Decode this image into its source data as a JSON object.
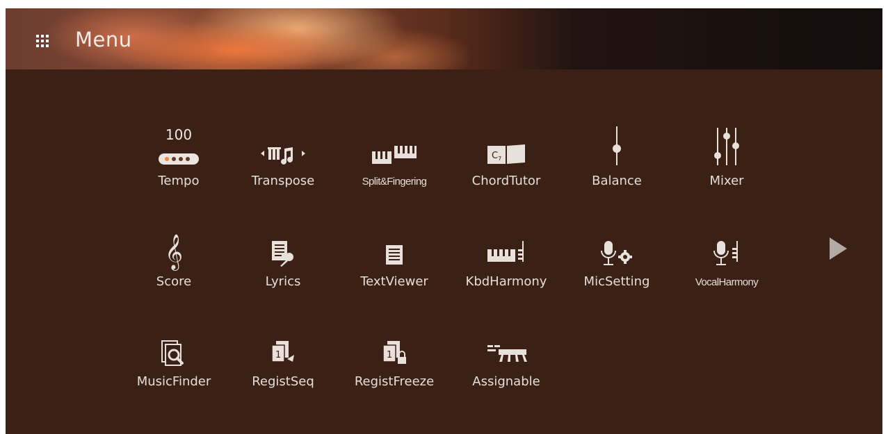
{
  "header": {
    "title": "Menu",
    "icon": "grid-icon"
  },
  "row1": [
    {
      "label": "Tempo",
      "icon": "tempo-icon",
      "value": "100"
    },
    {
      "label": "Transpose",
      "icon": "transpose-icon"
    },
    {
      "label": "Split&Fingering",
      "icon": "split-fingering-icon"
    },
    {
      "label": "ChordTutor",
      "icon": "chord-tutor-icon",
      "icon_text": "C7"
    },
    {
      "label": "Balance",
      "icon": "balance-icon"
    },
    {
      "label": "Mixer",
      "icon": "mixer-icon"
    }
  ],
  "row2": [
    {
      "label": "Score",
      "icon": "treble-clef-icon"
    },
    {
      "label": "Lyrics",
      "icon": "lyrics-icon"
    },
    {
      "label": "TextViewer",
      "icon": "text-viewer-icon"
    },
    {
      "label": "KbdHarmony",
      "icon": "kbd-harmony-icon"
    },
    {
      "label": "MicSetting",
      "icon": "mic-setting-icon"
    },
    {
      "label": "VocalHarmony",
      "icon": "vocal-harmony-icon"
    }
  ],
  "row3": [
    {
      "label": "MusicFinder",
      "icon": "music-finder-icon"
    },
    {
      "label": "RegistSeq",
      "icon": "regist-seq-icon"
    },
    {
      "label": "RegistFreeze",
      "icon": "regist-freeze-icon"
    },
    {
      "label": "Assignable",
      "icon": "assignable-icon"
    }
  ],
  "colors": {
    "background": "#3a2015",
    "text": "#e6ded8",
    "icon": "#e8e0da",
    "accent": "#f08a3c"
  },
  "navigation": {
    "next_icon": "next-page-arrow-icon"
  }
}
